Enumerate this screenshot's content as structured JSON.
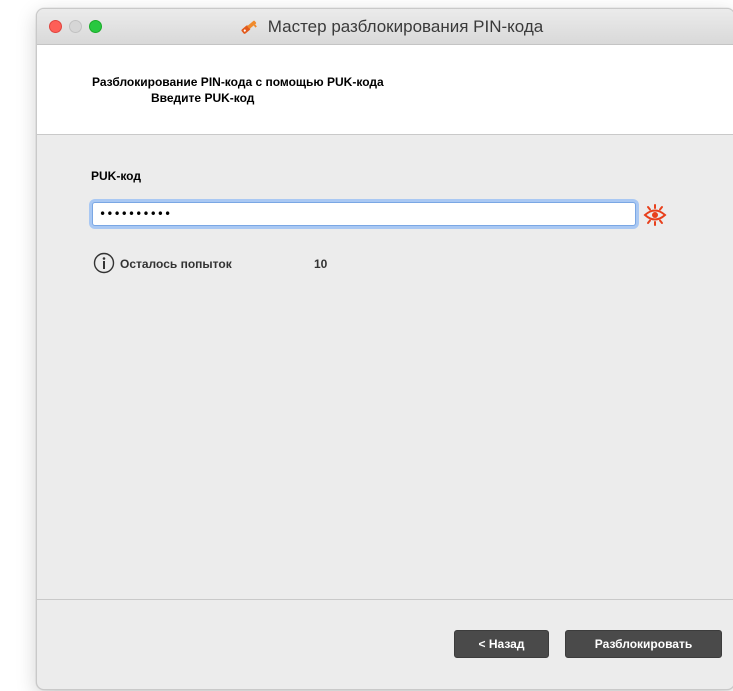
{
  "window": {
    "title": "Мастер разблокирования PIN-кода",
    "title_icon": "key-icon"
  },
  "header": {
    "title": "Разблокирование PIN-кода с помощью PUK-кода",
    "subtitle": "Введите PUK-код"
  },
  "form": {
    "puk_label": "PUK-код",
    "puk_value": "••••••••••",
    "show_password_icon": "eye-icon"
  },
  "info": {
    "icon": "info-icon",
    "attempts_label": "Осталось попыток",
    "attempts_value": "10"
  },
  "footer": {
    "back_label": "< Назад",
    "unlock_label": "Разблокировать"
  },
  "colors": {
    "accent_focus": "#7aa7e4",
    "eye_icon": "#e8401c",
    "button_bg": "#4a4a4a",
    "close": "#fe5f57",
    "minimize": "#d6d6d6",
    "maximize": "#28c840"
  }
}
